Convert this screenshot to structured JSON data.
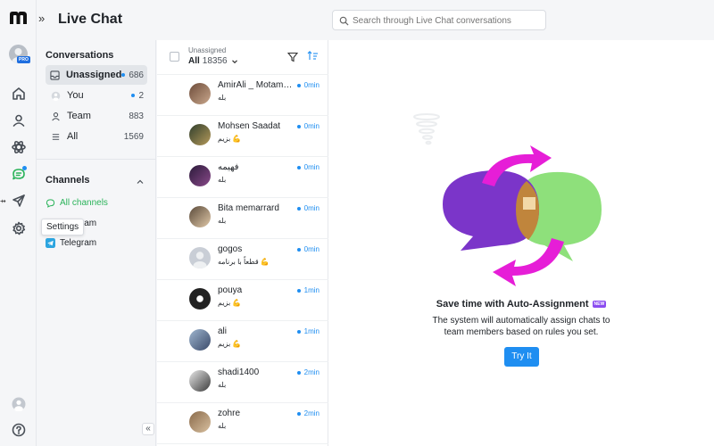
{
  "header": {
    "title": "Live Chat",
    "search_placeholder": "Search through Live Chat conversations"
  },
  "rail": {
    "badge": "PRO",
    "tooltip": "Settings"
  },
  "conversations": {
    "heading": "Conversations",
    "filters": [
      {
        "label": "Unassigned",
        "count": "686",
        "dot": true
      },
      {
        "label": "You",
        "count": "2",
        "dot": true
      },
      {
        "label": "Team",
        "count": "883",
        "dot": false
      },
      {
        "label": "All",
        "count": "1569",
        "dot": false
      }
    ]
  },
  "channels": {
    "heading": "Channels",
    "all_channels": "All channels",
    "items": [
      {
        "label": "Telegram"
      },
      {
        "label": "Telegram"
      }
    ]
  },
  "list": {
    "sub": "Unassigned",
    "filter_label": "All",
    "filter_count": "18356",
    "chats": [
      {
        "name": "AmirAli _ Motam…",
        "message": "بله",
        "time": "0min"
      },
      {
        "name": "Mohsen Saadat",
        "message": "بزیم 💪",
        "time": "0min"
      },
      {
        "name": "فهیمه",
        "message": "بله",
        "time": "0min"
      },
      {
        "name": "Bita memarrard",
        "message": "بله",
        "time": "0min"
      },
      {
        "name": "gogos",
        "message": "قطعاً با برنامه 💪",
        "time": "0min"
      },
      {
        "name": "pouya",
        "message": "بزیم 💪",
        "time": "1min"
      },
      {
        "name": "ali",
        "message": "بزیم 💪",
        "time": "1min"
      },
      {
        "name": "shadi1400",
        "message": "بله",
        "time": "2min"
      },
      {
        "name": "zohre",
        "message": "بله",
        "time": "2min"
      }
    ]
  },
  "promo": {
    "title": "Save time with Auto-Assignment",
    "badge": "NEW",
    "text_line1": "The system will automatically assign chats to",
    "text_line2": "team members based on rules you set.",
    "button": "Try It"
  },
  "colors": {
    "accent": "#1f8ef1",
    "purple_bubble": "#7b35c9",
    "green_bubble": "#8ee07b",
    "magenta": "#e61ed7"
  }
}
